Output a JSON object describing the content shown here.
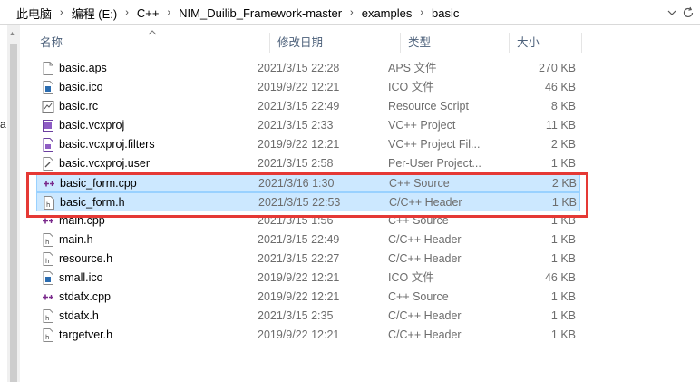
{
  "address": {
    "crumbs": [
      "此电脑",
      "编程 (E:)",
      "C++",
      "NIM_Duilib_Framework-master",
      "examples",
      "basic"
    ],
    "separator": "›"
  },
  "nav": {
    "clipped_letter": "a"
  },
  "columns": {
    "name": "名称",
    "date": "修改日期",
    "type": "类型",
    "size": "大小"
  },
  "files": [
    {
      "name": "basic.aps",
      "date": "2021/3/15 22:28",
      "type": "APS 文件",
      "size": "270 KB",
      "icon": "generic-file-icon"
    },
    {
      "name": "basic.ico",
      "date": "2019/9/22 12:21",
      "type": "ICO 文件",
      "size": "46 KB",
      "icon": "ico-file-icon"
    },
    {
      "name": "basic.rc",
      "date": "2021/3/15 22:49",
      "type": "Resource Script",
      "size": "8 KB",
      "icon": "rc-file-icon"
    },
    {
      "name": "basic.vcxproj",
      "date": "2021/3/15 2:33",
      "type": "VC++ Project",
      "size": "11 KB",
      "icon": "vcxproj-file-icon"
    },
    {
      "name": "basic.vcxproj.filters",
      "date": "2019/9/22 12:21",
      "type": "VC++ Project Fil...",
      "size": "2 KB",
      "icon": "vcxproj-filters-icon"
    },
    {
      "name": "basic.vcxproj.user",
      "date": "2021/3/15 2:58",
      "type": "Per-User Project...",
      "size": "1 KB",
      "icon": "vcxproj-user-icon"
    },
    {
      "name": "basic_form.cpp",
      "date": "2021/3/16 1:30",
      "type": "C++ Source",
      "size": "2 KB",
      "icon": "cpp-file-icon",
      "selected": true
    },
    {
      "name": "basic_form.h",
      "date": "2021/3/15 22:53",
      "type": "C/C++ Header",
      "size": "1 KB",
      "icon": "header-file-icon",
      "selected": true
    },
    {
      "name": "main.cpp",
      "date": "2021/3/15 1:56",
      "type": "C++ Source",
      "size": "1 KB",
      "icon": "cpp-file-icon"
    },
    {
      "name": "main.h",
      "date": "2021/3/15 22:49",
      "type": "C/C++ Header",
      "size": "1 KB",
      "icon": "header-file-icon"
    },
    {
      "name": "resource.h",
      "date": "2021/3/15 22:27",
      "type": "C/C++ Header",
      "size": "1 KB",
      "icon": "header-file-icon"
    },
    {
      "name": "small.ico",
      "date": "2019/9/22 12:21",
      "type": "ICO 文件",
      "size": "46 KB",
      "icon": "ico-file-icon"
    },
    {
      "name": "stdafx.cpp",
      "date": "2019/9/22 12:21",
      "type": "C++ Source",
      "size": "1 KB",
      "icon": "cpp-file-icon"
    },
    {
      "name": "stdafx.h",
      "date": "2021/3/15 2:35",
      "type": "C/C++ Header",
      "size": "1 KB",
      "icon": "header-file-icon"
    },
    {
      "name": "targetver.h",
      "date": "2019/9/22 12:21",
      "type": "C/C++ Header",
      "size": "1 KB",
      "icon": "header-file-icon"
    }
  ],
  "colors": {
    "selection_bg": "#cce8ff",
    "selection_border": "#99d1ff",
    "annotation_box": "#e53935",
    "header_text": "#4c607a",
    "detail_text": "#6d6d6d"
  }
}
